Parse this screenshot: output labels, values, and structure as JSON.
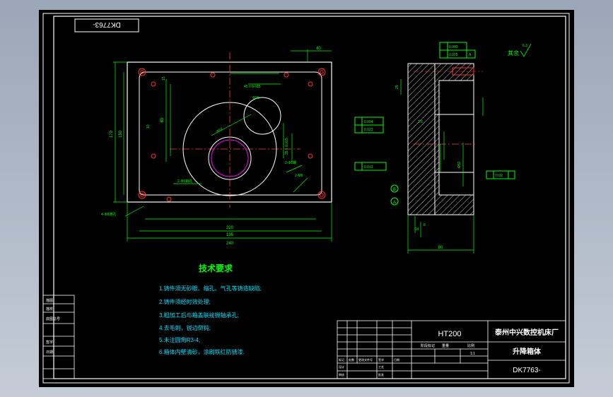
{
  "drawing": {
    "number_box": "DK7763-",
    "notes_title": "技术要求",
    "notes": [
      "1.铸件须无砂眼、缩孔、气孔等铸造缺陷;",
      "2.铸件须经时效处理;",
      "3.粗加工后与箱盖联接镗轴承孔;",
      "4.去毛刺，锐边倒钝;",
      "5.未注圆角R3-4;",
      "6.箱体内壁清砂，涂刷铁红防锈漆."
    ],
    "surface_finish_label": "其余",
    "surface_finish_value": "6.3"
  },
  "dimensions": {
    "top_40": "40",
    "overall_width": "240",
    "width_220": "220",
    "width_195": "195",
    "left_height": "170",
    "left_150": "150",
    "inner_height": "85",
    "small_15": "15",
    "small_10": "10",
    "holes_bottom_left": "4-Φ8通孔",
    "holes_mid": "2-Φ6销孔",
    "thread_holes": "2-Φ6螺",
    "threaded_right": "2-M6",
    "diam_45": "45 ± 0.015",
    "diam_big": "Φ52",
    "diam_r": "Φ90",
    "dim_35": "35 ± 0.015",
    "side_80": "80",
    "side_14": "14",
    "side_8": "8",
    "side_16": "1.6",
    "side_52": "Φ52",
    "side_25": "25"
  },
  "tolerances": {
    "top_1": "0.003",
    "top_2": "0.025",
    "top_ref": "A",
    "left_1": "0.004",
    "left_2": "0.023",
    "left_3": "0.013",
    "right_1": "0.02",
    "datum_a": "A",
    "datum_b": "B"
  },
  "title_block": {
    "material": "HT200",
    "company": "泰州中兴数控机床厂",
    "part_name": "升降箱体",
    "drawing_no": "DK7763-",
    "scale": "1:1",
    "row_labels": [
      "标记",
      "处数",
      "更改文件号",
      "签字",
      "日期"
    ],
    "stage_labels": [
      "阶段标记",
      "重量",
      "比例"
    ],
    "sign_labels": [
      "设计",
      "审核",
      "工艺",
      "批准"
    ],
    "left_cells": [
      "描图",
      "描校",
      "底图总号",
      "签字",
      "日期"
    ]
  },
  "colors": {
    "line": "#ffffff",
    "dim": "#00ff00",
    "hole": "#ff3030",
    "center": "#ff4040",
    "note": "#00e0ff",
    "bearing": "#ff00ff"
  }
}
